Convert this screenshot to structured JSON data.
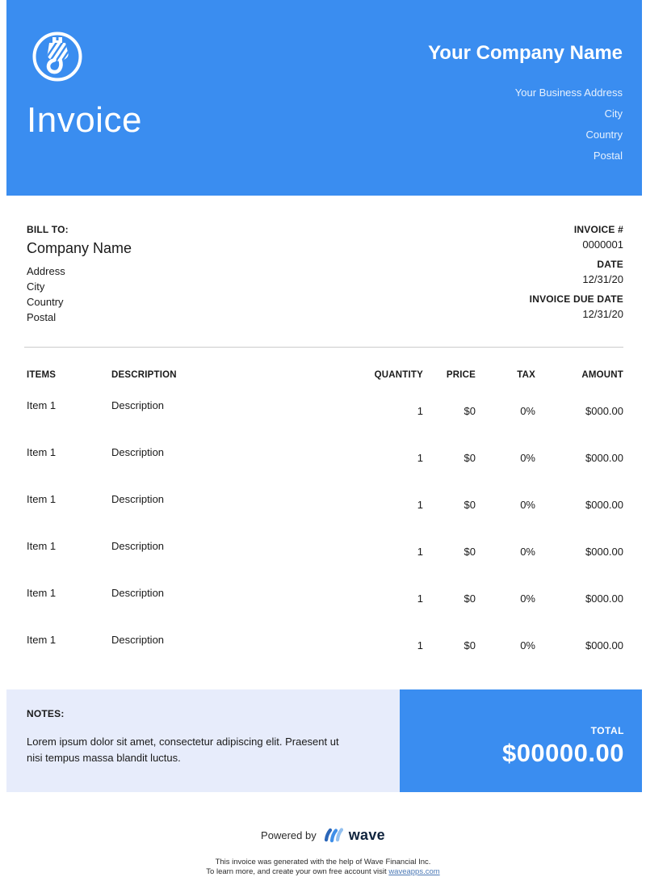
{
  "header": {
    "doc_title": "Invoice",
    "company_name": "Your Company Name",
    "address_lines": [
      "Your Business Address",
      "City",
      "Country",
      "Postal"
    ]
  },
  "bill_to": {
    "label": "BILL TO:",
    "company": "Company Name",
    "lines": [
      "Address",
      "City",
      "Country",
      "Postal"
    ]
  },
  "invoice_meta": [
    {
      "label": "INVOICE #",
      "value": "0000001"
    },
    {
      "label": "DATE",
      "value": "12/31/20"
    },
    {
      "label": "INVOICE DUE DATE",
      "value": "12/31/20"
    }
  ],
  "items_table": {
    "headers": [
      "ITEMS",
      "DESCRIPTION",
      "QUANTITY",
      "PRICE",
      "TAX",
      "AMOUNT"
    ],
    "rows": [
      {
        "item": "Item 1",
        "description": "Description",
        "quantity": "1",
        "price": "$0",
        "tax": "0%",
        "amount": "$000.00"
      },
      {
        "item": "Item 1",
        "description": "Description",
        "quantity": "1",
        "price": "$0",
        "tax": "0%",
        "amount": "$000.00"
      },
      {
        "item": "Item 1",
        "description": "Description",
        "quantity": "1",
        "price": "$0",
        "tax": "0%",
        "amount": "$000.00"
      },
      {
        "item": "Item 1",
        "description": "Description",
        "quantity": "1",
        "price": "$0",
        "tax": "0%",
        "amount": "$000.00"
      },
      {
        "item": "Item 1",
        "description": "Description",
        "quantity": "1",
        "price": "$0",
        "tax": "0%",
        "amount": "$000.00"
      },
      {
        "item": "Item 1",
        "description": "Description",
        "quantity": "1",
        "price": "$0",
        "tax": "0%",
        "amount": "$000.00"
      }
    ]
  },
  "notes": {
    "label": "NOTES:",
    "text": "Lorem ipsum dolor sit amet, consectetur adipiscing elit. Praesent ut nisi tempus massa blandit luctus."
  },
  "total": {
    "label": "TOTAL",
    "value": "$00000.00"
  },
  "footer": {
    "powered_by": "Powered by",
    "brand": "wave",
    "line1": "This invoice was generated with the help of Wave Financial Inc.",
    "line2_prefix": "To learn more, and create your own free account visit ",
    "link": "waveapps.com"
  },
  "colors": {
    "brand_blue": "#3A8DF0",
    "notes_bg": "#E7ECFB",
    "link_blue": "#4A78B5"
  }
}
